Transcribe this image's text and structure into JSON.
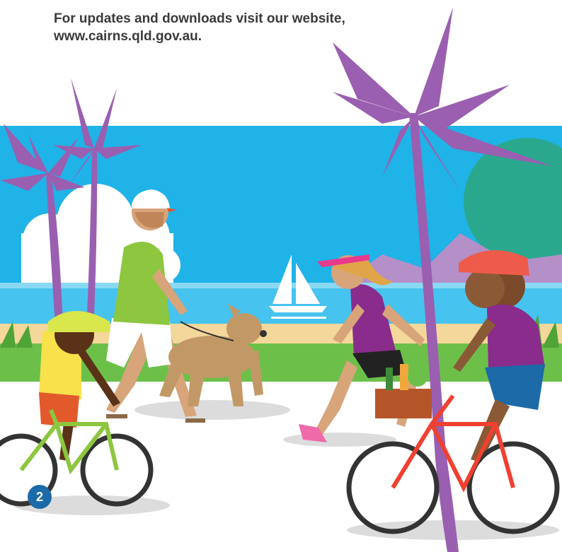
{
  "header": {
    "line1": "For updates and downloads visit our website,",
    "line2": "www.cairns.qld.gov.au."
  },
  "page": {
    "number": "2"
  },
  "colors": {
    "sky": "#1fb3e8",
    "sea": "#46c3ee",
    "sand": "#f4d79a",
    "grass": "#6cc04a",
    "path": "#ffffff",
    "palm": "#9a5fb0",
    "boat_sail": "#ffffff"
  },
  "illustration": {
    "figures": [
      "walking-man",
      "dog",
      "child-cyclist",
      "runner",
      "woman-cyclist"
    ],
    "icons": [
      "palm-tree-icon",
      "sailboat-icon",
      "bicycle-icon",
      "dog-icon"
    ]
  }
}
